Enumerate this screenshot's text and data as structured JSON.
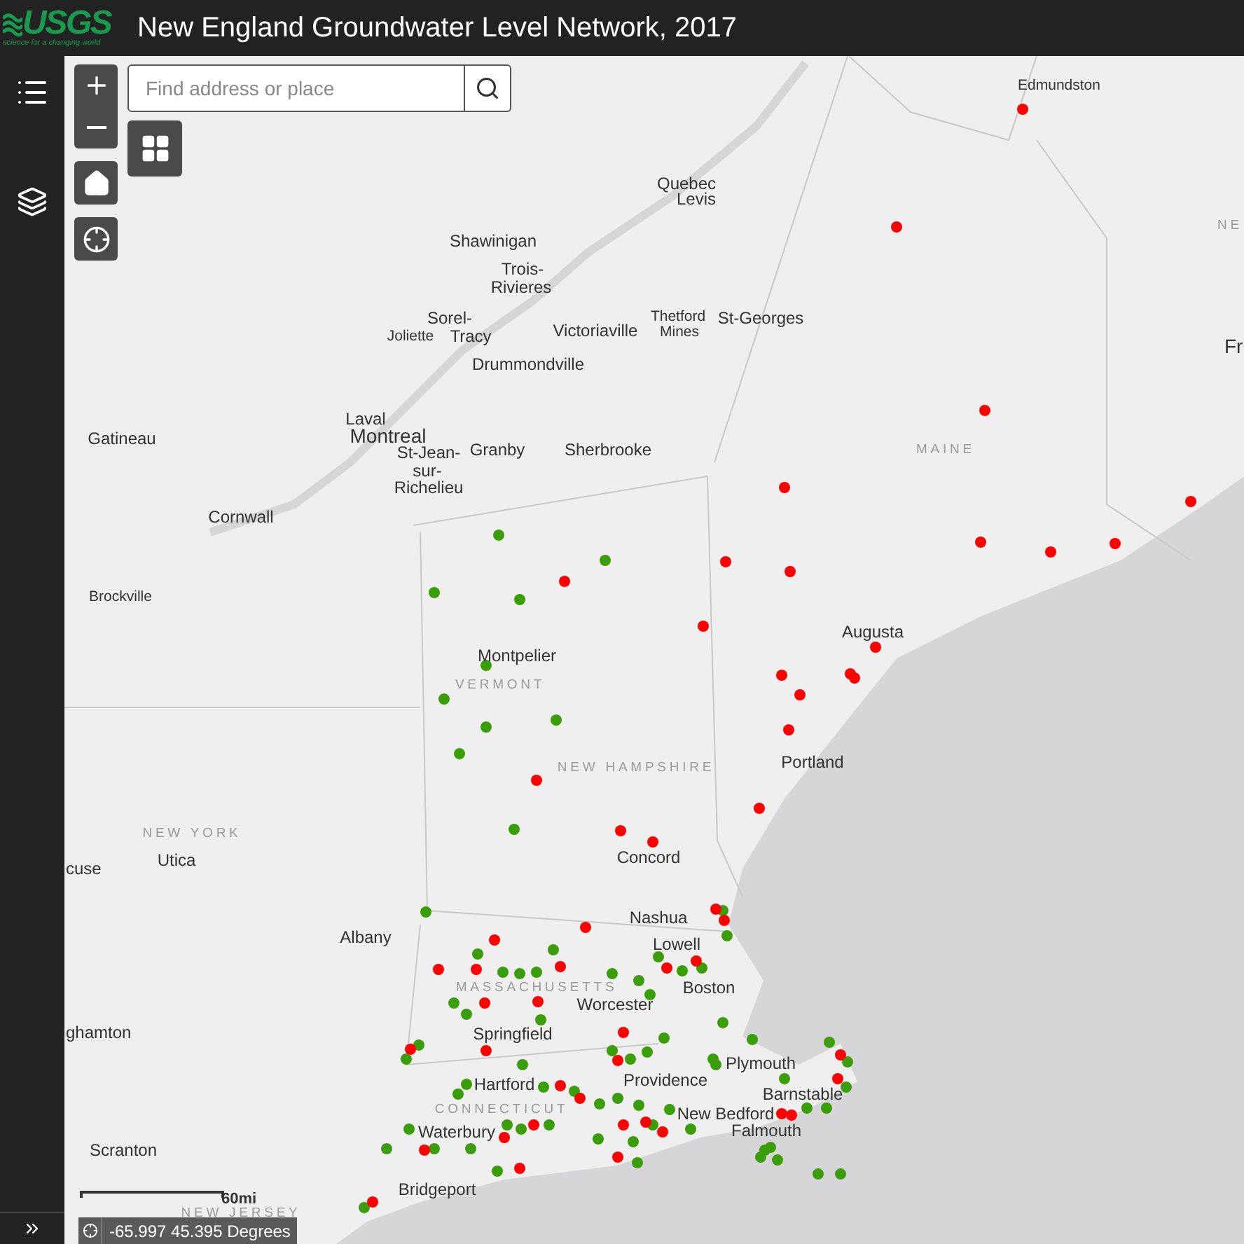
{
  "header": {
    "logo_text": "USGS",
    "logo_tagline": "science for a changing world",
    "title": "New England Groundwater Level Network, 2017"
  },
  "search": {
    "placeholder": "Find address or place"
  },
  "map": {
    "labels": [
      {
        "text": "Edmundston",
        "kind": "small"
      },
      {
        "text": "Quebec",
        "kind": "city"
      },
      {
        "text": "Levis",
        "kind": "city"
      },
      {
        "text": "Shawinigan",
        "kind": "city"
      },
      {
        "text": "Trois-",
        "kind": "city"
      },
      {
        "text": "Rivieres",
        "kind": "city"
      },
      {
        "text": "Sorel-",
        "kind": "city"
      },
      {
        "text": "Joliette",
        "kind": "small"
      },
      {
        "text": "Tracy",
        "kind": "city"
      },
      {
        "text": "Victoriaville",
        "kind": "city"
      },
      {
        "text": "Thetford",
        "kind": "small"
      },
      {
        "text": "Mines",
        "kind": "small"
      },
      {
        "text": "St-Georges",
        "kind": "city"
      },
      {
        "text": "Drummondville",
        "kind": "city"
      },
      {
        "text": "Laval",
        "kind": "city"
      },
      {
        "text": "Montreal",
        "kind": "large"
      },
      {
        "text": "St-Jean-",
        "kind": "city"
      },
      {
        "text": "sur-",
        "kind": "city"
      },
      {
        "text": "Richelieu",
        "kind": "city"
      },
      {
        "text": "Granby",
        "kind": "city"
      },
      {
        "text": "Sherbrooke",
        "kind": "city"
      },
      {
        "text": "Gatineau",
        "kind": "city"
      },
      {
        "text": "Cornwall",
        "kind": "city"
      },
      {
        "text": "Brockville",
        "kind": "small"
      },
      {
        "text": "MAINE",
        "kind": "region"
      },
      {
        "text": "NE",
        "kind": "region"
      },
      {
        "text": "Fr",
        "kind": "large"
      },
      {
        "text": "Montpelier",
        "kind": "city"
      },
      {
        "text": "VERMONT",
        "kind": "region"
      },
      {
        "text": "NEW HAMPSHIRE",
        "kind": "region"
      },
      {
        "text": "Augusta",
        "kind": "city"
      },
      {
        "text": "Portland",
        "kind": "city"
      },
      {
        "text": "NEW YORK",
        "kind": "region"
      },
      {
        "text": "Utica",
        "kind": "city"
      },
      {
        "text": "cuse",
        "kind": "city"
      },
      {
        "text": "Concord",
        "kind": "city"
      },
      {
        "text": "Albany",
        "kind": "city"
      },
      {
        "text": "Nashua",
        "kind": "city"
      },
      {
        "text": "Lowell",
        "kind": "city"
      },
      {
        "text": "Boston",
        "kind": "city"
      },
      {
        "text": "MASSACHUSETTS",
        "kind": "region"
      },
      {
        "text": "Worcester",
        "kind": "city"
      },
      {
        "text": "Springfield",
        "kind": "city"
      },
      {
        "text": "ghamton",
        "kind": "city"
      },
      {
        "text": "Plymouth",
        "kind": "city"
      },
      {
        "text": "Hartford",
        "kind": "city"
      },
      {
        "text": "Providence",
        "kind": "city"
      },
      {
        "text": "Barnstable",
        "kind": "city"
      },
      {
        "text": "CONNECTICUT",
        "kind": "region"
      },
      {
        "text": "Waterbury",
        "kind": "city"
      },
      {
        "text": "New Bedford",
        "kind": "city"
      },
      {
        "text": "Falmouth",
        "kind": "city"
      },
      {
        "text": "Scranton",
        "kind": "city"
      },
      {
        "text": "Bridgeport",
        "kind": "city"
      },
      {
        "text": "NEW JERSEY",
        "kind": "region"
      }
    ]
  },
  "scale_bar": {
    "label": "60mi"
  },
  "coordinates": {
    "text": "-65.997 45.395 Degrees"
  }
}
